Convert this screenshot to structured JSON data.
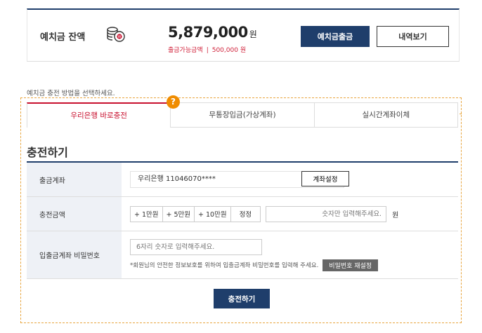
{
  "balance": {
    "title": "예치금 잔액",
    "amount": "5,879,000",
    "unit": "원",
    "available_label": "출금가능금액",
    "available_value": "500,000 원",
    "withdraw_button": "예치금출금",
    "history_button": "내역보기"
  },
  "instruction": "예치금 충전 방법을 선택하세요.",
  "help_badge": "?",
  "tabs": [
    {
      "label": "우리은행 바로충전",
      "active": true
    },
    {
      "label": "무통장입금(가상계좌)",
      "active": false
    },
    {
      "label": "실시간계좌이체",
      "active": false
    }
  ],
  "section_title": "충전하기",
  "form": {
    "account": {
      "label": "출금계좌",
      "value": "우리은행 11046070****",
      "button": "계좌설정"
    },
    "amount": {
      "label": "충전금액",
      "buttons": [
        "+ 1만원",
        "+ 5만원",
        "+ 10만원",
        "정정"
      ],
      "placeholder": "숫자만 입력해주세요.",
      "unit": "원"
    },
    "password": {
      "label": "입출금계좌 비밀번호",
      "placeholder": "6자리 숫자로 입력해주세요.",
      "note": "*회원님의 안전한 정보보호를 위하여 입출금계좌 비밀번호를 입력해 주세요.",
      "reset_button": "비밀번호 재설정"
    }
  },
  "submit_button": "충전하기",
  "colors": {
    "navy": "#1f3e6b",
    "accent_red": "#c8102e",
    "help_orange": "#f08c00",
    "dashed_frame": "#e8a640"
  }
}
